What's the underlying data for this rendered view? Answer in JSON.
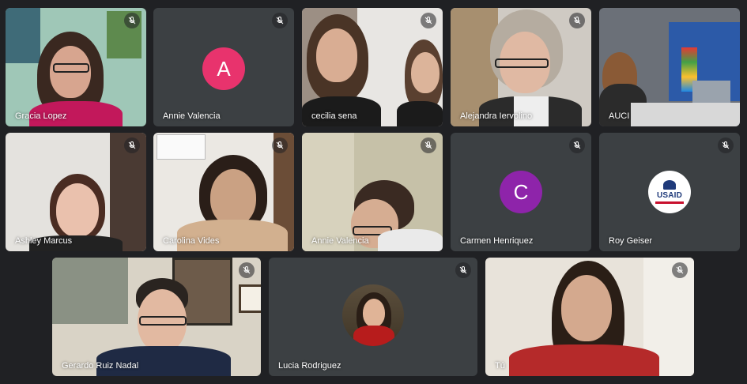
{
  "colors": {
    "background": "#202124",
    "tile": "#3c4043",
    "avatar_a": "#e8336d",
    "avatar_c": "#8e24aa"
  },
  "icons": {
    "mic": "mic-off-icon"
  },
  "participants": {
    "gracia_lopez": {
      "name": "Gracia Lopez"
    },
    "annie_valencia_avatar": {
      "name": "Annie Valencia",
      "initial": "A"
    },
    "cecilia_sena": {
      "name": "cecilia sena"
    },
    "alejandra_iervolino": {
      "name": "Alejandra Iervolino"
    },
    "auci": {
      "name": "AUCI"
    },
    "ashley_marcus": {
      "name": "Ashley Marcus"
    },
    "carolina_vides": {
      "name": "Carolina Vides"
    },
    "annie_valencia_video": {
      "name": "Annie Valencia"
    },
    "carmen_henriquez": {
      "name": "Carmen Henriquez",
      "initial": "C"
    },
    "roy_geiser": {
      "name": "Roy Geiser",
      "logo_text": "USAID"
    },
    "gerardo_ruiz_nadal": {
      "name": "Gerardo Ruiz Nadal"
    },
    "lucia_rodriguez": {
      "name": "Lucia Rodriguez"
    },
    "tu": {
      "name": "Tú"
    }
  }
}
